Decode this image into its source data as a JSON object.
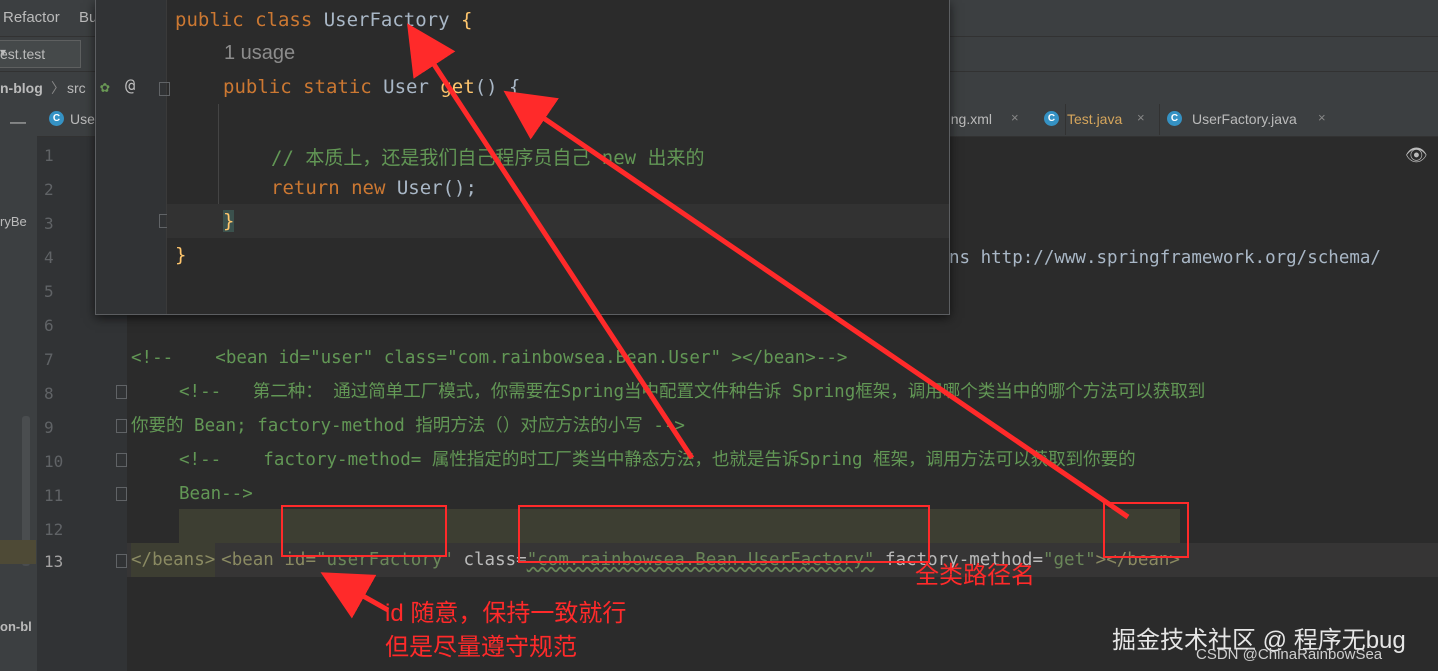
{
  "menu": {
    "refactor": "Refactor",
    "build": "Bu"
  },
  "run_config": {
    "label": "est.test",
    "chevron": "▾"
  },
  "breadcrumb": {
    "project": "n-blog",
    "sep": "〉",
    "folder": "src"
  },
  "sidebar": {
    "item1": "ryBe",
    "item2": "on-bl"
  },
  "tabs": [
    {
      "label": "Use",
      "icon": "C"
    },
    {
      "label": "ring.xml",
      "close": "×"
    },
    {
      "label": "Test.java",
      "icon": "C",
      "close": "×"
    },
    {
      "label": "UserFactory.java",
      "icon": "C",
      "close": "×"
    }
  ],
  "line_numbers": [
    "1",
    "2",
    "3",
    "4",
    "5",
    "6",
    "7",
    "8",
    "9",
    "10",
    "11",
    "12",
    "13"
  ],
  "popup": {
    "class_decl_kw": "public class ",
    "class_name": "UserFactory",
    "brace_open": " {",
    "usage": "1 usage",
    "method_kw": "public static ",
    "method_type": "User ",
    "method_name": "get",
    "method_rest": "() {",
    "comment": "// 本质上，还是我们自己程序员自己 new 出来的",
    "return_kw": "return new ",
    "return_rest": "User();",
    "brace_method_close": "}",
    "brace_class_close": "}"
  },
  "code": {
    "line4": "ns http://www.springframework.org/schema/",
    "line7": "<!--    <bean id=\"user\" class=\"com.rainbowsea.Bean.User\" ></bean>-->",
    "line8": "<!--   第二种： 通过简单工厂模式，你需要在Spring当中配置文件种告诉 Spring框架，调用哪个类当中的哪个方法可以获取到",
    "line9": "你要的 Bean; factory-method 指明方法（）对应方法的小写 -->",
    "line10": "<!--    factory-method= 属性指定的时工厂类当中静态方法，也就是告诉Spring 框架，调用方法可以获取到你要的",
    "line11": "Bean-->",
    "line12_a": "<bean id=",
    "line12_b": "\"userFactory\"",
    "line12_c": " class=",
    "line12_d": "\"com.rainbowsea.Bean.UserFactory\"",
    "line12_e": " factory-method=",
    "line12_f": "\"get\"",
    "line12_g": "></bean>",
    "line13": "</beans>"
  },
  "annotations": {
    "full_path": "全类路径名",
    "id_note_1": "id 随意，保持一致就行",
    "id_note_2": "但是尽量遵守规范"
  },
  "watermark": {
    "juejin": "掘金技术社区 @ 程序无bug",
    "csdn": "CSDN @ChinaRainbowSea"
  },
  "colors": {
    "annotation_red": "#ff2a2a",
    "keyword": "#cc7832",
    "function": "#ffc66d",
    "comment": "#629755",
    "string": "#6a8759"
  }
}
